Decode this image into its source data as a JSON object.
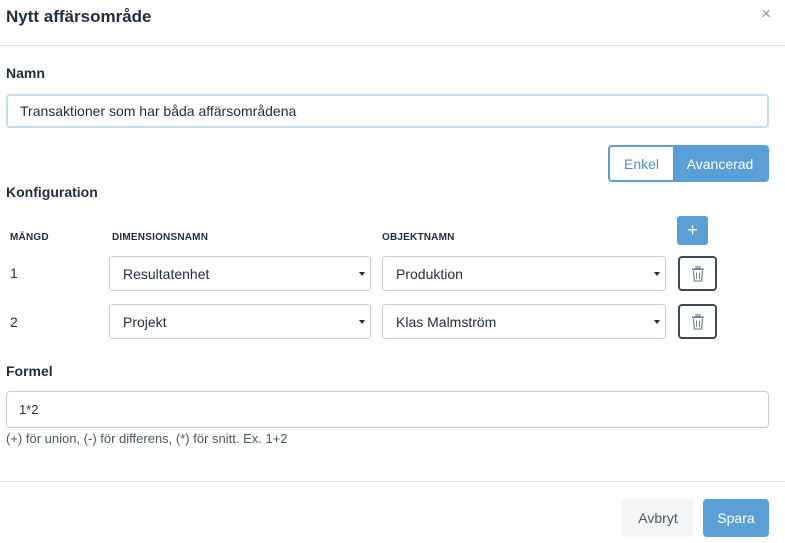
{
  "modal": {
    "title": "Nytt affärsområde",
    "close_glyph": "×"
  },
  "name_section": {
    "label": "Namn",
    "value": "Transaktioner som har båda affärsområdena"
  },
  "mode_toggle": {
    "simple_label": "Enkel",
    "advanced_label": "Avancerad",
    "selected": "Avancerad"
  },
  "config": {
    "label": "Konfiguration",
    "columns": {
      "set": "MÄNGD",
      "dimension": "DIMENSIONSNAMN",
      "object": "OBJEKTNAMN"
    },
    "add_glyph": "+",
    "rows": [
      {
        "set": "1",
        "dimension": "Resultatenhet",
        "object": "Produktion"
      },
      {
        "set": "2",
        "dimension": "Projekt",
        "object": "Klas Malmström"
      }
    ]
  },
  "formula": {
    "label": "Formel",
    "value": "1*2",
    "help": "(+) för union, (-) för differens, (*) för snitt. Ex. 1+2"
  },
  "footer": {
    "cancel_label": "Avbryt",
    "save_label": "Spara"
  },
  "colors": {
    "accent": "#5aa0d6",
    "text": "#1f2d3d",
    "border": "#c5ccd4"
  },
  "icons": {
    "close": "close-icon",
    "add": "plus-icon",
    "delete": "trash-icon",
    "dropdown": "caret-down-icon"
  }
}
